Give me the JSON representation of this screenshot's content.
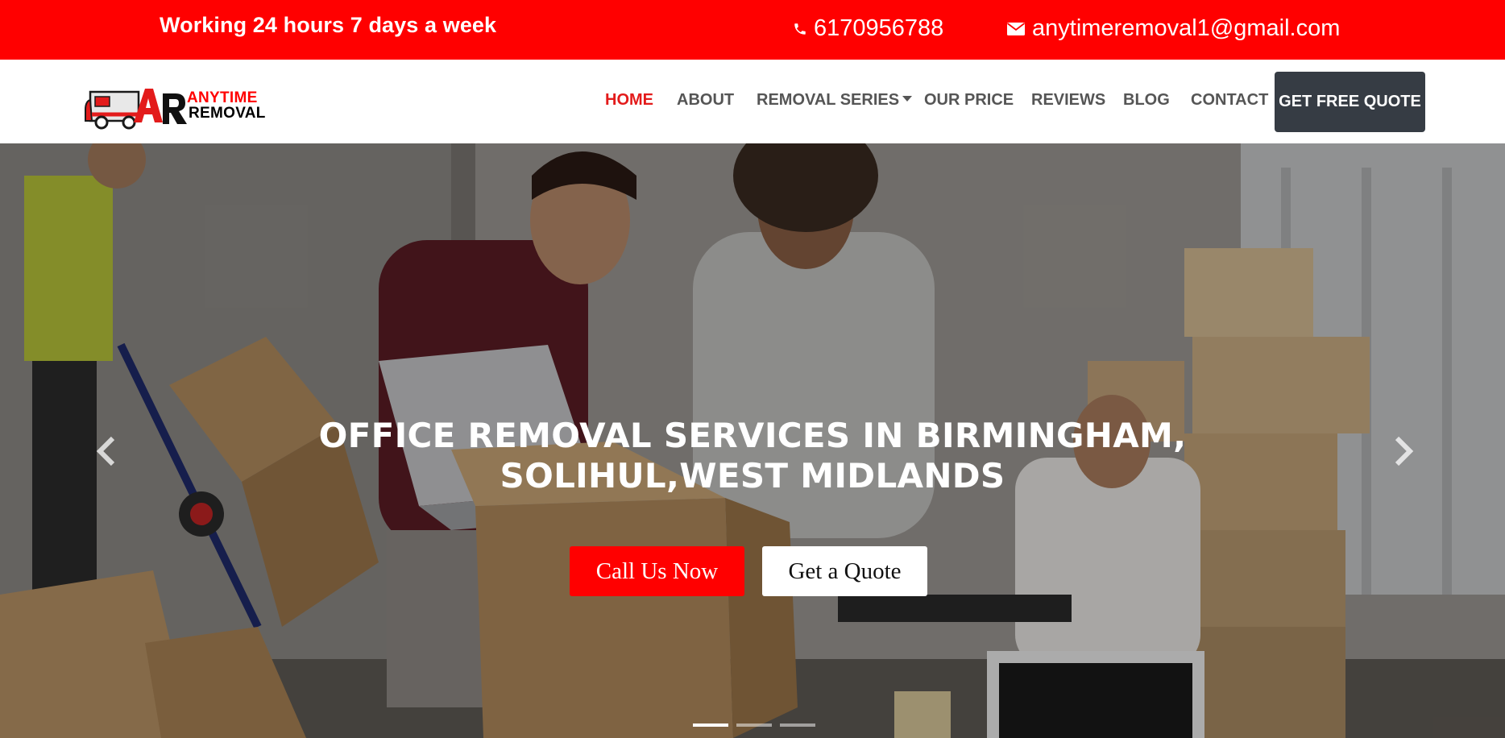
{
  "topbar": {
    "hours": "Working 24 hours 7 days a week",
    "phone": "6170956788",
    "email": "anytimeremoval1@gmail.com",
    "background": "#ff0000"
  },
  "header": {
    "logo": {
      "mark": "AR",
      "line1": "ANYTIME",
      "line2": "REMOVAL",
      "icon": "truck-icon"
    },
    "nav": [
      {
        "label": "HOME",
        "active": true
      },
      {
        "label": "ABOUT"
      },
      {
        "label": "REMOVAL SERIES",
        "dropdown": true
      },
      {
        "label": "OUR PRICE"
      },
      {
        "label": "REVIEWS"
      },
      {
        "label": "BLOG"
      },
      {
        "label": "CONTACT"
      }
    ],
    "cta": "GET FREE QUOTE"
  },
  "hero": {
    "title": "OFFICE REMOVAL SERVICES IN BIRMINGHAM, SOLIHUL,WEST MIDLANDS",
    "buttons": {
      "call": "Call Us Now",
      "quote": "Get a Quote"
    },
    "slides_total": 3,
    "active_slide": 1,
    "accent": "#ff0000",
    "dark": "#363c44"
  }
}
